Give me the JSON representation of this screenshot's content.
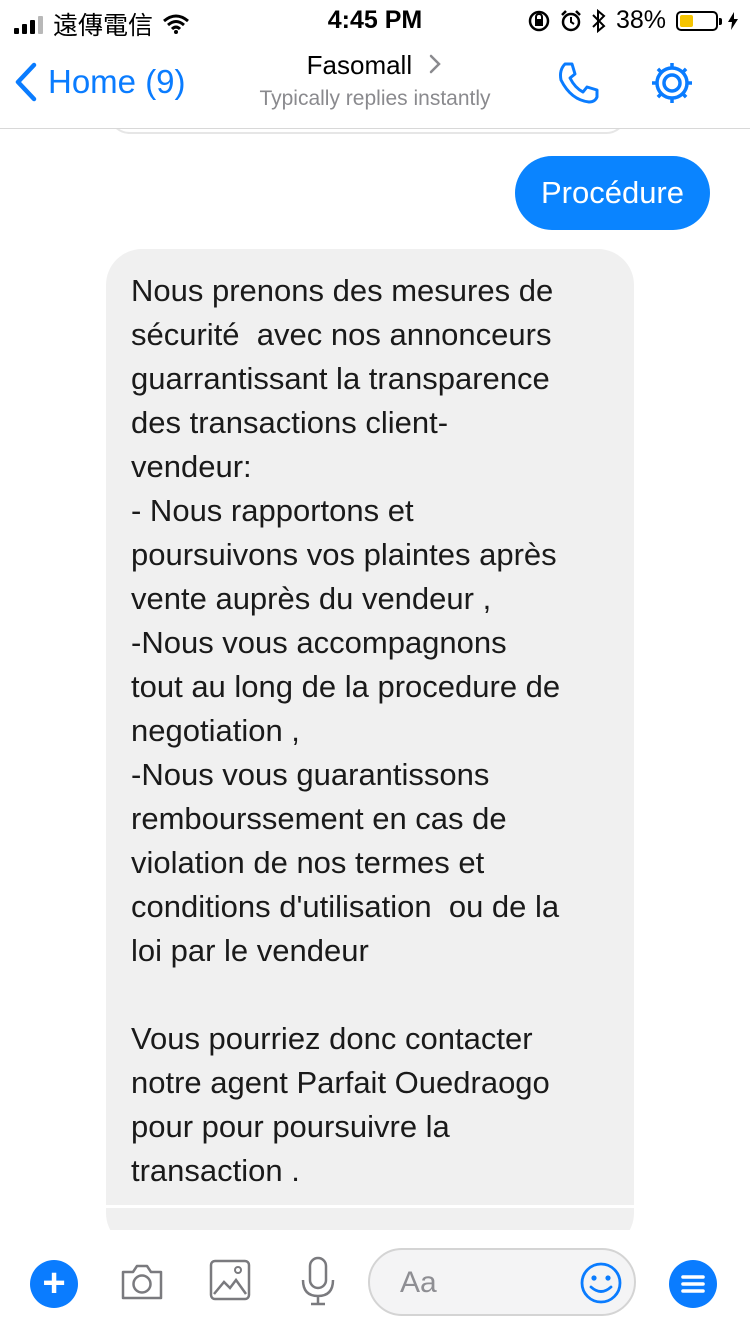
{
  "status_bar": {
    "carrier": "遠傳電信",
    "time": "4:45 PM",
    "battery_percent": "38%",
    "battery_level": 0.38
  },
  "nav": {
    "back_label": "Home (9)",
    "title": "Fasomall",
    "subtitle": "Typically replies instantly",
    "icons": [
      "phone-icon",
      "gear-icon"
    ]
  },
  "messages": {
    "outgoing": "Procédure",
    "incoming": "Nous prenons des mesures de\nsécurité  avec nos annonceurs\nguarrantissant la transparence\ndes transactions client-\nvendeur:\n- Nous rapportons et\npoursuivons vos plaintes après\nvente auprès du vendeur ,\n-Nous vous accompagnons\ntout au long de la procedure de\nnegotiation ,\n-Nous vous guarantissons\nrembourssement en cas de\nviolation de nos termes et\nconditions d'utilisation  ou de la\nloi par le vendeur\n\nVous pourriez donc contacter\nnotre agent Parfait Ouedraogo\npour pour poursuivre la\ntransaction ."
  },
  "composer": {
    "placeholder": "Aa",
    "icons": [
      "plus-icon",
      "camera-icon",
      "image-icon",
      "microphone-icon",
      "emoji-icon",
      "menu-icon"
    ]
  },
  "colors": {
    "accent": "#0a7cff",
    "outgoing_bubble": "#0a84ff",
    "incoming_bubble": "#f0f0f0",
    "battery": "#f5c400"
  }
}
